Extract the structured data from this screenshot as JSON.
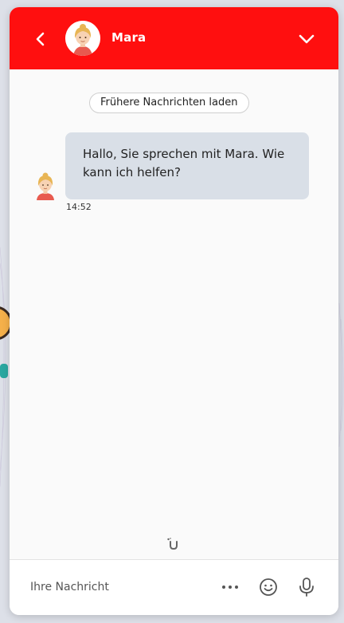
{
  "header": {
    "agent_name": "Mara",
    "back_icon": "chevron-left-icon",
    "collapse_icon": "chevron-down-icon",
    "background_color": "#ff0f0f"
  },
  "messages": {
    "load_more_label": "Frühere Nachrichten laden",
    "items": [
      {
        "sender": "Mara",
        "text": "Hallo, Sie sprechen mit Mara. Wie kann ich helfen?",
        "time": "14:52"
      }
    ]
  },
  "composer": {
    "placeholder": "Ihre Nachricht",
    "value": "",
    "more_icon": "more-dots-icon",
    "emoji_icon": "smiley-icon",
    "mic_icon": "microphone-icon"
  },
  "colors": {
    "accent": "#ff0f0f",
    "bubble": "#d9dfe7"
  }
}
